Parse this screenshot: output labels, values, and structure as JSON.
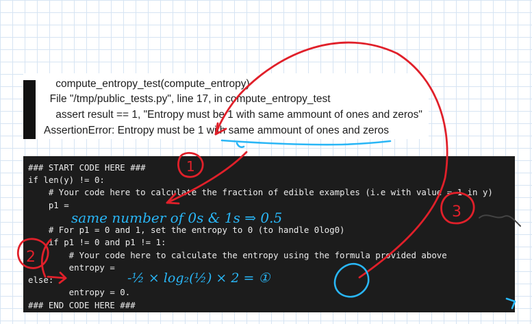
{
  "traceback": {
    "lines": [
      "    compute_entropy_test(compute_entropy)",
      "  File \"/tmp/public_tests.py\", line 17, in compute_entropy_test",
      "    assert result == 1, \"Entropy must be 1 with same ammount of ones and zeros\"",
      "AssertionError: Entropy must be 1 with same ammount of ones and zeros"
    ]
  },
  "code": {
    "lines": [
      "### START CODE HERE ###",
      "if len(y) != 0:",
      "    # Your code here to calculate the fraction of edible examples (i.e with value = 1 in y)",
      "    p1 =",
      "",
      "    # For p1 = 0 and 1, set the entropy to 0 (to handle 0log0)",
      "    if p1 != 0 and p1 != 1:",
      "        # Your code here to calculate the entropy using the formula provided above",
      "        entropy =",
      "else:",
      "        entropy = 0.",
      "### END CODE HERE ###"
    ]
  },
  "annotations": {
    "marker_1": "1",
    "marker_2": "2",
    "marker_3": "3",
    "note_p1": "same number of 0s & 1s ⇒ 0.5",
    "note_entropy": "-½ × log₂(½) × 2 = ①"
  },
  "colors": {
    "ink_blue": "#29b6f6",
    "ink_red": "#e0202a",
    "code_bg": "#1c1c1c"
  }
}
